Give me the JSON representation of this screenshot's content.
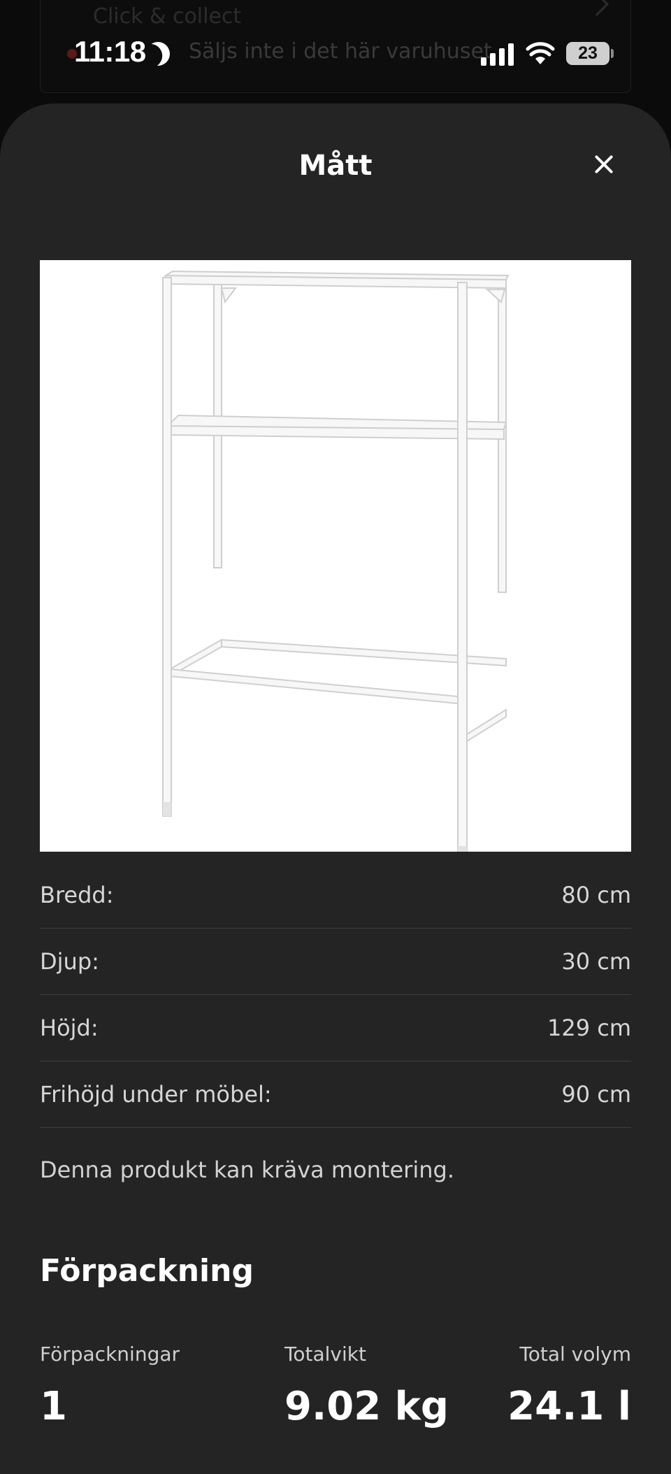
{
  "background": {
    "line1": "Click & collect",
    "line2": "Säljs inte i det här varuhuset"
  },
  "status_bar": {
    "time": "11:18",
    "battery": "23"
  },
  "sheet": {
    "title": "Mått"
  },
  "dimensions": [
    {
      "label": "Bredd:",
      "value": "80 cm"
    },
    {
      "label": "Djup:",
      "value": "30 cm"
    },
    {
      "label": "Höjd:",
      "value": "129 cm"
    },
    {
      "label": "Frihöjd under möbel:",
      "value": "90 cm"
    }
  ],
  "note": "Denna produkt kan kräva montering.",
  "packaging": {
    "title": "Förpackning",
    "stats": [
      {
        "label": "Förpackningar",
        "value": "1"
      },
      {
        "label": "Totalvikt",
        "value": "9.02 kg"
      },
      {
        "label": "Total volym",
        "value": "24.1 l"
      }
    ]
  }
}
